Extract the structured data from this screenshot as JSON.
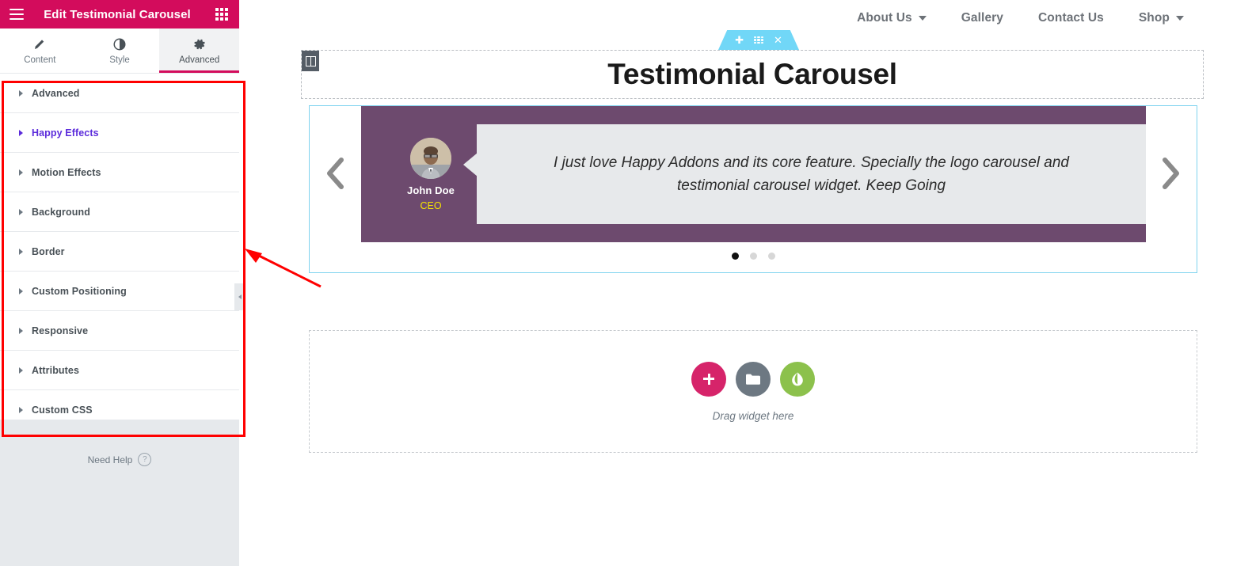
{
  "panel": {
    "title": "Edit Testimonial Carousel",
    "menu_icon": "hamburger-icon",
    "apps_icon": "grid-icon",
    "tabs": [
      {
        "label": "Content",
        "icon": "pencil-icon",
        "active": false
      },
      {
        "label": "Style",
        "icon": "contrast-icon",
        "active": false
      },
      {
        "label": "Advanced",
        "icon": "gear-icon",
        "active": true
      }
    ],
    "sections": [
      {
        "label": "Advanced",
        "highlighted": false
      },
      {
        "label": "Happy Effects",
        "highlighted": true
      },
      {
        "label": "Motion Effects",
        "highlighted": false
      },
      {
        "label": "Background",
        "highlighted": false
      },
      {
        "label": "Border",
        "highlighted": false
      },
      {
        "label": "Custom Positioning",
        "highlighted": false
      },
      {
        "label": "Responsive",
        "highlighted": false
      },
      {
        "label": "Attributes",
        "highlighted": false
      },
      {
        "label": "Custom CSS",
        "highlighted": false
      }
    ],
    "need_help": "Need Help",
    "help_icon": "question-circle-icon",
    "collapse_icon": "chevron-right-icon"
  },
  "site_nav": [
    {
      "label": "About Us",
      "has_dropdown": true
    },
    {
      "label": "Gallery",
      "has_dropdown": false
    },
    {
      "label": "Contact Us",
      "has_dropdown": false
    },
    {
      "label": "Shop",
      "has_dropdown": true
    }
  ],
  "section_toolbar": {
    "add_icon": "plus-icon",
    "handle_icon": "grid-dots-icon",
    "close_icon": "close-icon"
  },
  "canvas": {
    "edit_handle_icon": "columns-icon",
    "heading": "Testimonial Carousel",
    "carousel": {
      "prev_icon": "chevron-left-icon",
      "next_icon": "chevron-right-icon",
      "name": "John Doe",
      "role": "CEO",
      "quote": "I just love Happy Addons and its core feature. Specially the logo carousel and testimonial carousel widget. Keep Going",
      "dots": [
        {
          "active": true
        },
        {
          "active": false
        },
        {
          "active": false
        }
      ]
    },
    "dropzone": {
      "label": "Drag widget here",
      "buttons": [
        {
          "name": "add-widget-button",
          "icon": "plus-icon",
          "color": "#d6246a"
        },
        {
          "name": "templates-button",
          "icon": "folder-icon",
          "color": "#6d7882"
        },
        {
          "name": "happy-addons-button",
          "icon": "leaf-icon",
          "color": "#8cc14c"
        }
      ]
    }
  },
  "colors": {
    "brand_pink": "#d30c5c",
    "happy_purple": "#5b2bdb",
    "annotation_red": "#ff0000",
    "selection_blue": "#7fd3ef",
    "carousel_bg": "#6d4a6e",
    "role_yellow": "#f5e400"
  }
}
